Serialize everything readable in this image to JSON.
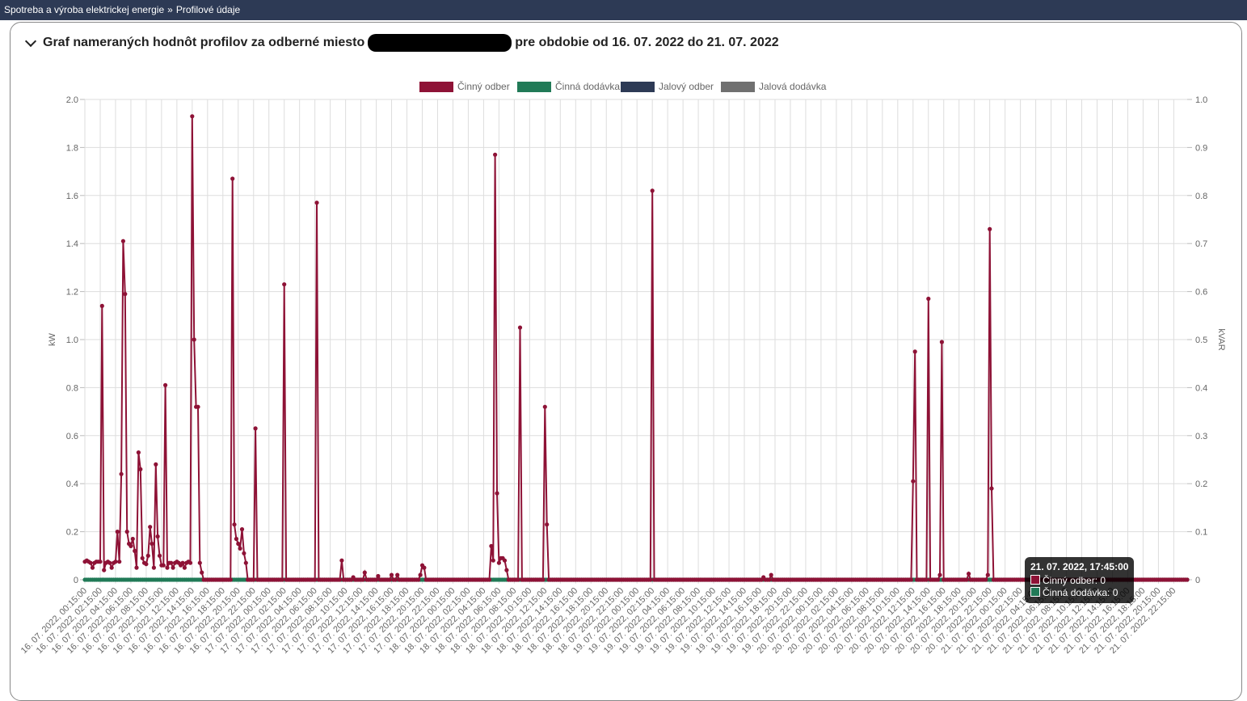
{
  "breadcrumb": {
    "items": [
      "Spotreba a výroba elektrickej energie",
      "Profilové údaje"
    ],
    "separator": "»"
  },
  "title": {
    "prefix": "Graf nameraných hodnôt profilov za odberné miesto",
    "suffix": "pre obdobie od 16. 07. 2022 do 21. 07. 2022"
  },
  "colors": {
    "navbar": "#2d3a55",
    "cinny_odber": "#8e1236",
    "cinna_dodavka": "#217a57",
    "jalovy_odber": "#2d3a55",
    "jalova_dodavka": "#707070"
  },
  "tooltip": {
    "title": "21. 07. 2022, 17:45:00",
    "lines": [
      "Činný odber: 0",
      "Činná dodávka: 0"
    ]
  },
  "chart_data": {
    "type": "line",
    "legend_position": "top",
    "grid": true,
    "ylabel_left": "kW",
    "ylabel_right": "kVAR",
    "ylim_left": [
      0,
      2.0
    ],
    "ylim_right": [
      0,
      1.0
    ],
    "yticks_left": [
      "0",
      "0.2",
      "0.4",
      "0.6",
      "0.8",
      "1.0",
      "1.2",
      "1.4",
      "1.6",
      "1.8",
      "2.0"
    ],
    "yticks_right": [
      "0",
      "0.1",
      "0.2",
      "0.3",
      "0.4",
      "0.5",
      "0.6",
      "0.7",
      "0.8",
      "0.9",
      "1.0"
    ],
    "x_interval_minutes": 15,
    "x_range": [
      "16. 07. 2022, 00:15:00",
      "22. 07. 2022, 00:00:00"
    ],
    "x_tick_every": "2 h",
    "legend": [
      "Činný odber",
      "Činná dodávka",
      "Jalový odber",
      "Jalová dodávka"
    ],
    "series": [
      {
        "name": "Činný odber",
        "axis": "left",
        "default": 0,
        "points": [
          [
            "16.07 00:15",
            0.075
          ],
          [
            "16.07 00:30",
            0.08
          ],
          [
            "16.07 00:45",
            0.075
          ],
          [
            "16.07 01:00",
            0.07
          ],
          [
            "16.07 01:15",
            0.05
          ],
          [
            "16.07 01:30",
            0.07
          ],
          [
            "16.07 01:45",
            0.075
          ],
          [
            "16.07 02:00",
            0.075
          ],
          [
            "16.07 02:15",
            0.075
          ],
          [
            "16.07 02:30",
            1.14
          ],
          [
            "16.07 02:45",
            0.04
          ],
          [
            "16.07 03:00",
            0.07
          ],
          [
            "16.07 03:15",
            0.075
          ],
          [
            "16.07 03:30",
            0.07
          ],
          [
            "16.07 03:45",
            0.05
          ],
          [
            "16.07 04:00",
            0.07
          ],
          [
            "16.07 04:15",
            0.075
          ],
          [
            "16.07 04:30",
            0.2
          ],
          [
            "16.07 04:45",
            0.075
          ],
          [
            "16.07 05:00",
            0.44
          ],
          [
            "16.07 05:15",
            1.41
          ],
          [
            "16.07 05:30",
            1.19
          ],
          [
            "16.07 05:45",
            0.2
          ],
          [
            "16.07 06:00",
            0.15
          ],
          [
            "16.07 06:15",
            0.14
          ],
          [
            "16.07 06:30",
            0.17
          ],
          [
            "16.07 06:45",
            0.12
          ],
          [
            "16.07 07:00",
            0.05
          ],
          [
            "16.07 07:15",
            0.53
          ],
          [
            "16.07 07:30",
            0.46
          ],
          [
            "16.07 07:45",
            0.09
          ],
          [
            "16.07 08:00",
            0.07
          ],
          [
            "16.07 08:15",
            0.065
          ],
          [
            "16.07 08:30",
            0.1
          ],
          [
            "16.07 08:45",
            0.22
          ],
          [
            "16.07 09:00",
            0.15
          ],
          [
            "16.07 09:15",
            0.05
          ],
          [
            "16.07 09:30",
            0.48
          ],
          [
            "16.07 09:45",
            0.18
          ],
          [
            "16.07 10:00",
            0.1
          ],
          [
            "16.07 10:15",
            0.06
          ],
          [
            "16.07 10:30",
            0.06
          ],
          [
            "16.07 10:45",
            0.81
          ],
          [
            "16.07 11:00",
            0.05
          ],
          [
            "16.07 11:15",
            0.07
          ],
          [
            "16.07 11:30",
            0.07
          ],
          [
            "16.07 11:45",
            0.05
          ],
          [
            "16.07 12:00",
            0.07
          ],
          [
            "16.07 12:15",
            0.075
          ],
          [
            "16.07 12:30",
            0.07
          ],
          [
            "16.07 12:45",
            0.06
          ],
          [
            "16.07 13:00",
            0.07
          ],
          [
            "16.07 13:15",
            0.05
          ],
          [
            "16.07 13:30",
            0.07
          ],
          [
            "16.07 13:45",
            0.075
          ],
          [
            "16.07 14:00",
            0.07
          ],
          [
            "16.07 14:15",
            1.93
          ],
          [
            "16.07 14:30",
            1.0
          ],
          [
            "16.07 14:45",
            0.72
          ],
          [
            "16.07 15:00",
            0.72
          ],
          [
            "16.07 15:15",
            0.07
          ],
          [
            "16.07 15:30",
            0.03
          ],
          [
            "16.07 19:30",
            1.67
          ],
          [
            "16.07 19:45",
            0.23
          ],
          [
            "16.07 20:00",
            0.17
          ],
          [
            "16.07 20:15",
            0.15
          ],
          [
            "16.07 20:30",
            0.13
          ],
          [
            "16.07 20:45",
            0.21
          ],
          [
            "16.07 21:00",
            0.11
          ],
          [
            "16.07 21:15",
            0.07
          ],
          [
            "16.07 22:30",
            0.63
          ],
          [
            "17.07 02:15",
            1.23
          ],
          [
            "17.07 06:30",
            1.57
          ],
          [
            "17.07 09:45",
            0.08
          ],
          [
            "17.07 11:15",
            0.01
          ],
          [
            "17.07 12:45",
            0.03
          ],
          [
            "17.07 14:30",
            0.015
          ],
          [
            "17.07 16:15",
            0.02
          ],
          [
            "17.07 17:00",
            0.02
          ],
          [
            "17.07 20:00",
            0.02
          ],
          [
            "17.07 20:15",
            0.06
          ],
          [
            "17.07 20:30",
            0.05
          ],
          [
            "18.07 05:15",
            0.14
          ],
          [
            "18.07 05:30",
            0.08
          ],
          [
            "18.07 05:45",
            1.77
          ],
          [
            "18.07 06:00",
            0.36
          ],
          [
            "18.07 06:15",
            0.07
          ],
          [
            "18.07 06:30",
            0.09
          ],
          [
            "18.07 06:45",
            0.09
          ],
          [
            "18.07 07:00",
            0.08
          ],
          [
            "18.07 07:15",
            0.04
          ],
          [
            "18.07 09:00",
            1.05
          ],
          [
            "18.07 12:15",
            0.72
          ],
          [
            "18.07 12:30",
            0.23
          ],
          [
            "19.07 02:15",
            1.62
          ],
          [
            "19.07 16:45",
            0.01
          ],
          [
            "19.07 17:45",
            0.02
          ],
          [
            "20.07 12:15",
            0.41
          ],
          [
            "20.07 12:30",
            0.95
          ],
          [
            "20.07 14:15",
            1.17
          ],
          [
            "20.07 15:45",
            0.02
          ],
          [
            "20.07 16:00",
            0.99
          ],
          [
            "20.07 19:30",
            0.025
          ],
          [
            "20.07 22:00",
            0.02
          ],
          [
            "20.07 22:15",
            1.46
          ],
          [
            "20.07 22:30",
            0.38
          ]
        ]
      },
      {
        "name": "Činná dodávka",
        "axis": "left",
        "default": 0,
        "points": []
      },
      {
        "name": "Jalový odber",
        "axis": "right",
        "default": null,
        "points": []
      },
      {
        "name": "Jalová dodávka",
        "axis": "right",
        "default": null,
        "points": []
      }
    ]
  }
}
